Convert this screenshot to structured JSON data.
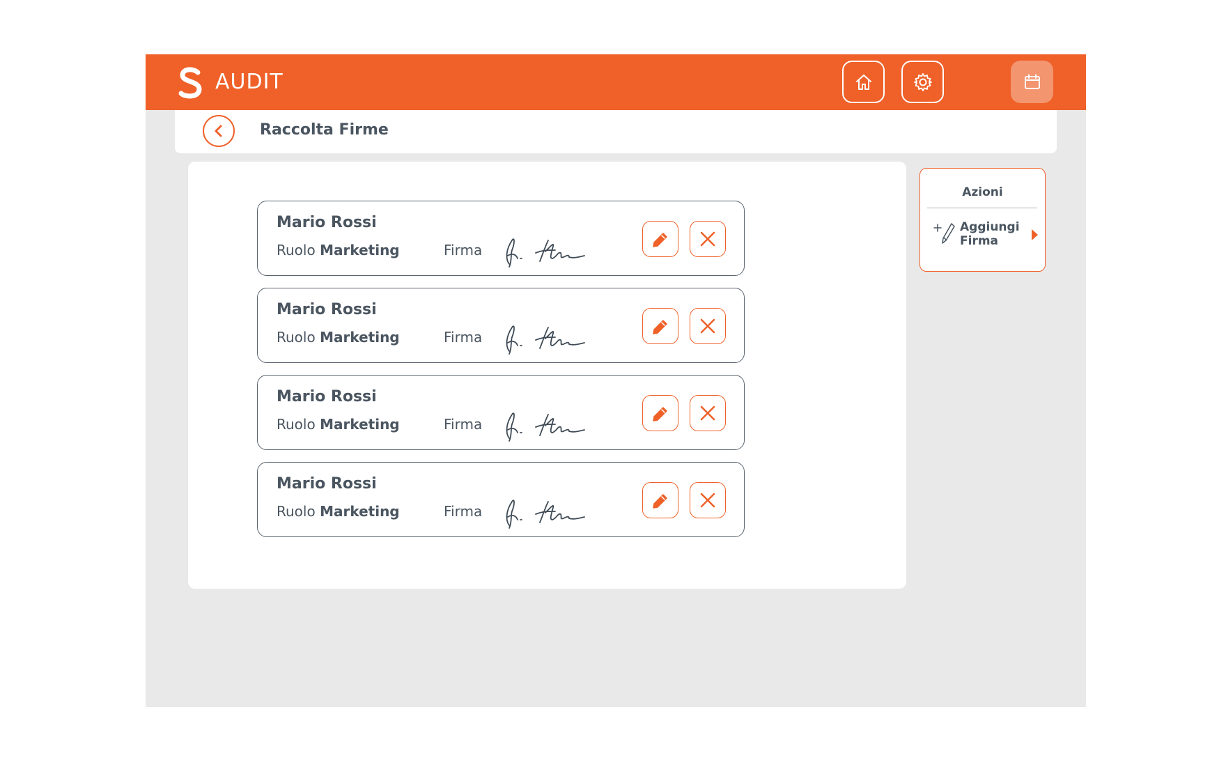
{
  "app": {
    "title": "AUDIT",
    "logo_icon": "s-logo-icon",
    "accent_color": "#ef6129"
  },
  "nav": {
    "home_icon": "home-icon",
    "settings_icon": "gear-icon",
    "calendar_icon": "calendar-icon"
  },
  "header": {
    "back_icon": "chevron-left-icon",
    "page_title": "Raccolta Firme"
  },
  "signatures": [
    {
      "name": "Mario Rossi",
      "role_label": "Ruolo",
      "role_value": "Marketing",
      "sign_label": "Firma"
    },
    {
      "name": "Mario Rossi",
      "role_label": "Ruolo",
      "role_value": "Marketing",
      "sign_label": "Firma"
    },
    {
      "name": "Mario Rossi",
      "role_label": "Ruolo",
      "role_value": "Marketing",
      "sign_label": "Firma"
    },
    {
      "name": "Mario Rossi",
      "role_label": "Ruolo",
      "role_value": "Marketing",
      "sign_label": "Firma"
    }
  ],
  "actions": {
    "title": "Azioni",
    "add_signature_line1": "Aggiungi",
    "add_signature_line2": "Firma",
    "add_icon": "add-pen-icon",
    "arrow_icon": "caret-right-icon"
  }
}
